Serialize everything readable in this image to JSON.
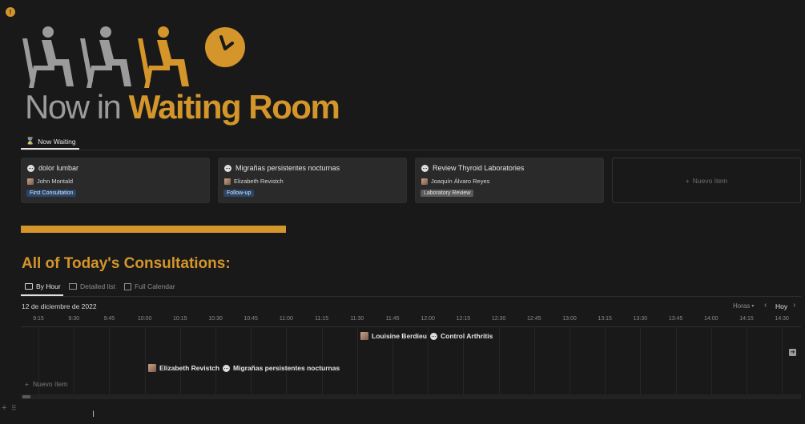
{
  "app": {
    "page_icon": "speech-bubble-icon"
  },
  "header": {
    "title_prefix": "Now in",
    "title_emphasis": "Waiting Room",
    "accent_color": "#d4952a",
    "gray_color": "#9b9b9b"
  },
  "waiting_view": {
    "tab_label": "Now Waiting",
    "cards": [
      {
        "title": "dolor lumbar",
        "person": "John Montald",
        "tag": "First Consultation",
        "tag_color": "#28456c"
      },
      {
        "title": "Migrañas persistentes nocturnas",
        "person": "Elizabeth Revistch",
        "tag": "Follow-up",
        "tag_color": "#28456c"
      },
      {
        "title": "Review Thyroid Laboratories",
        "person": "Joaquín Álvaro Reyes",
        "tag": "Laboratory Review",
        "tag_color": "#5a5a5a"
      }
    ],
    "new_item_label": "Nuevo ítem"
  },
  "consultations": {
    "heading": "All of Today's Consultations:",
    "tabs": [
      {
        "label": "By Hour",
        "icon": "timeline-icon",
        "active": true
      },
      {
        "label": "Detailed list",
        "icon": "table-icon",
        "active": false
      },
      {
        "label": "Full Calendar",
        "icon": "calendar-icon",
        "active": false
      }
    ],
    "date": "12 de diciembre de 2022",
    "scale_label": "Horas",
    "today_label": "Hoy",
    "times": [
      "9:15",
      "9:30",
      "9:45",
      "10:00",
      "10:15",
      "10:30",
      "10:45",
      "11:00",
      "11:15",
      "11:30",
      "11:45",
      "12:00",
      "12:15",
      "12:30",
      "12:45",
      "13:00",
      "13:15",
      "13:30",
      "13:45",
      "14:00",
      "14:15",
      "14:30"
    ],
    "events": [
      {
        "label": "Louisine Berdieu",
        "kind": "person"
      },
      {
        "label": "Control Arthritis",
        "kind": "chat"
      },
      {
        "label": "Elizabeth Revistch",
        "kind": "person"
      },
      {
        "label": "Migrañas persistentes nocturnas",
        "kind": "chat"
      }
    ],
    "new_item_label": "Nuevo ítem"
  }
}
